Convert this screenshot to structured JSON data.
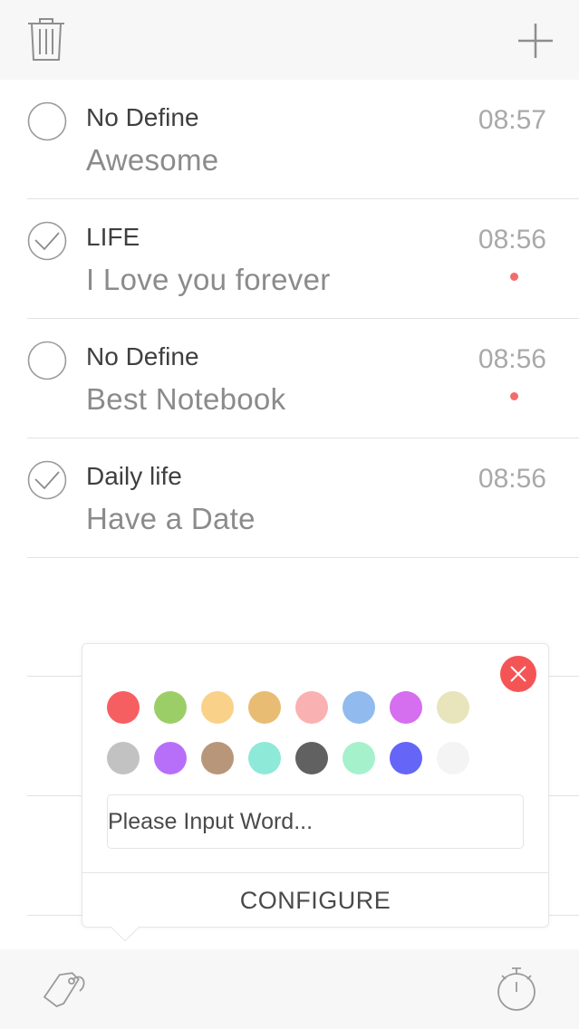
{
  "toolbar": {
    "trash_icon": "trash-icon",
    "add_icon": "plus-icon"
  },
  "notes": [
    {
      "category": "No Define",
      "text": "Awesome",
      "time": "08:57",
      "checked": false,
      "flagged": false
    },
    {
      "category": "LIFE",
      "text": "I Love you forever",
      "time": "08:56",
      "checked": true,
      "flagged": true
    },
    {
      "category": "No Define",
      "text": "Best Notebook",
      "time": "08:56",
      "checked": false,
      "flagged": true
    },
    {
      "category": "Daily life",
      "text": "Have a Date",
      "time": "08:56",
      "checked": true,
      "flagged": false
    }
  ],
  "popover": {
    "close_icon": "close-icon",
    "colors": [
      "#f65f61",
      "#9cce67",
      "#f9d189",
      "#e8bd73",
      "#f9b2b1",
      "#91bbee",
      "#d66ef0",
      "#e8e4bb",
      "#c2c2c2",
      "#b76ff9",
      "#b89679",
      "#8ee9d9",
      "#616161",
      "#a5f1cb",
      "#6565f8",
      "#f4f4f4"
    ],
    "input_placeholder": "Please Input Word...",
    "input_value": "",
    "configure_label": "CONFIGURE"
  },
  "bottombar": {
    "tag_icon": "tag-icon",
    "timer_icon": "stopwatch-icon"
  },
  "accent": {
    "flag_dot": "#f46b6b",
    "close": "#f55455"
  }
}
